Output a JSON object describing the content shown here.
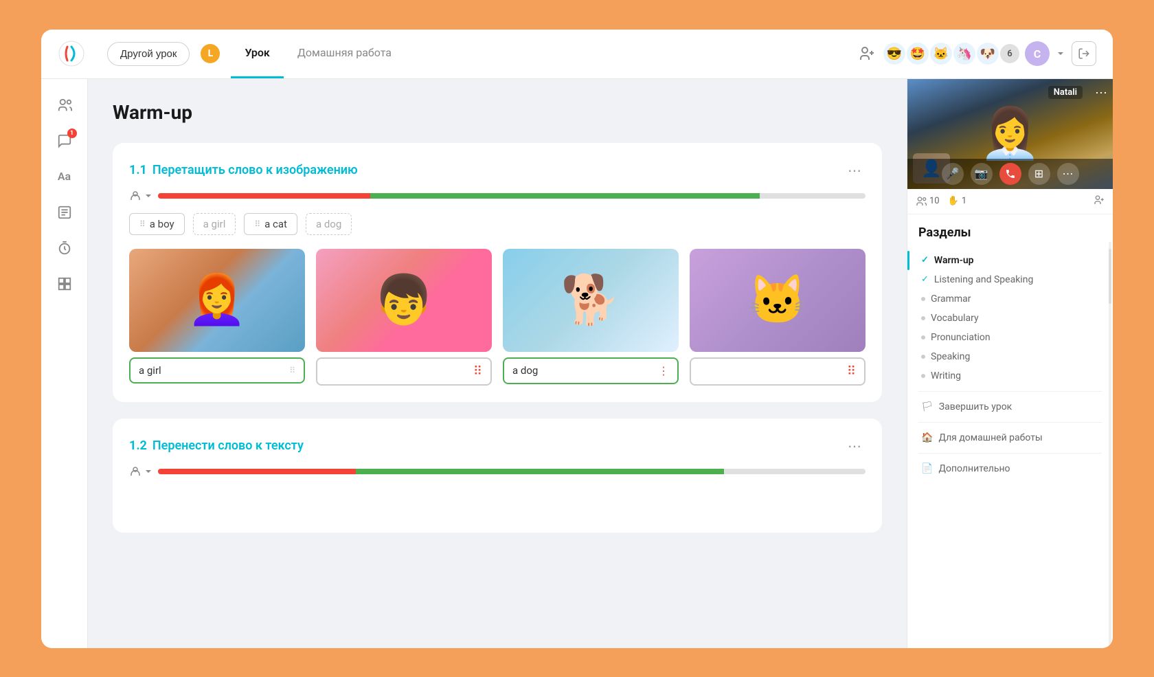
{
  "header": {
    "logo_alt": "App logo",
    "nav_btn_label": "Другой урок",
    "level_badge": "L",
    "tabs": [
      {
        "id": "urok",
        "label": "Урок",
        "active": true
      },
      {
        "id": "homework",
        "label": "Домашняя работа",
        "active": false
      }
    ],
    "add_user_label": "+👤",
    "avatars": [
      "😎",
      "🤩",
      "🐱",
      "🦄",
      "🐶"
    ],
    "avatar_count": "6",
    "user_initial": "С",
    "logout_icon": "→|"
  },
  "sidebar": {
    "icons": [
      {
        "id": "users",
        "symbol": "👥",
        "badge": null
      },
      {
        "id": "messages",
        "symbol": "💬",
        "badge": "1"
      },
      {
        "id": "translate",
        "symbol": "Aа",
        "badge": null
      },
      {
        "id": "notes",
        "symbol": "📋",
        "badge": null
      },
      {
        "id": "timer",
        "symbol": "⏱",
        "badge": null
      },
      {
        "id": "grid",
        "symbol": "⊞",
        "badge": null
      }
    ]
  },
  "page": {
    "title": "Warm-up"
  },
  "exercises": [
    {
      "number": "1.1",
      "title": "Перетащить слово к изображению",
      "progress_red_pct": 30,
      "progress_green_pct": 55,
      "word_chips": [
        {
          "label": "a boy",
          "has_handle": true
        },
        {
          "label": "a girl",
          "has_handle": false
        },
        {
          "label": "a cat",
          "has_handle": true
        },
        {
          "label": "a dog",
          "has_handle": false
        }
      ],
      "images": [
        {
          "type": "girl",
          "emoji": "👩‍🦰",
          "answer": "a girl",
          "state": "correct",
          "bg": "#d4a872"
        },
        {
          "type": "boy",
          "emoji": "👦",
          "answer": "",
          "state": "empty",
          "bg": "#f4a0c0"
        },
        {
          "type": "dog",
          "emoji": "🐕",
          "answer": "a dog",
          "state": "active-blue",
          "bg": "#87ceeb"
        },
        {
          "type": "cat",
          "emoji": "🐱",
          "answer": "",
          "state": "empty",
          "bg": "#c8a0dc"
        }
      ]
    },
    {
      "number": "1.2",
      "title": "Перенести слово к тексту",
      "progress_red_pct": 28,
      "progress_green_pct": 52
    }
  ],
  "video_panel": {
    "teacher_name": "Natali",
    "more_label": "⋯",
    "controls": [
      {
        "id": "mic",
        "symbol": "🎤",
        "color": "default"
      },
      {
        "id": "camera",
        "symbol": "📷",
        "color": "default"
      },
      {
        "id": "hangup",
        "symbol": "📵",
        "color": "red"
      },
      {
        "id": "grid",
        "symbol": "⊞",
        "color": "default"
      },
      {
        "id": "more",
        "symbol": "⋯",
        "color": "default"
      }
    ],
    "stats": {
      "users": "10",
      "hand": "1"
    }
  },
  "sections": {
    "title": "Разделы",
    "items": [
      {
        "id": "warmup",
        "label": "Warm-up",
        "state": "checked-active"
      },
      {
        "id": "listening",
        "label": "Listening and Speaking",
        "state": "checked"
      },
      {
        "id": "grammar",
        "label": "Grammar",
        "state": "dot"
      },
      {
        "id": "vocabulary",
        "label": "Vocabulary",
        "state": "dot"
      },
      {
        "id": "pronunciation",
        "label": "Pronunciation",
        "state": "dot"
      },
      {
        "id": "speaking",
        "label": "Speaking",
        "state": "dot"
      },
      {
        "id": "writing",
        "label": "Writing",
        "state": "dot"
      }
    ],
    "finish_label": "Завершить урок",
    "homework_label": "Для домашней работы",
    "extra_label": "Дополнительно"
  }
}
